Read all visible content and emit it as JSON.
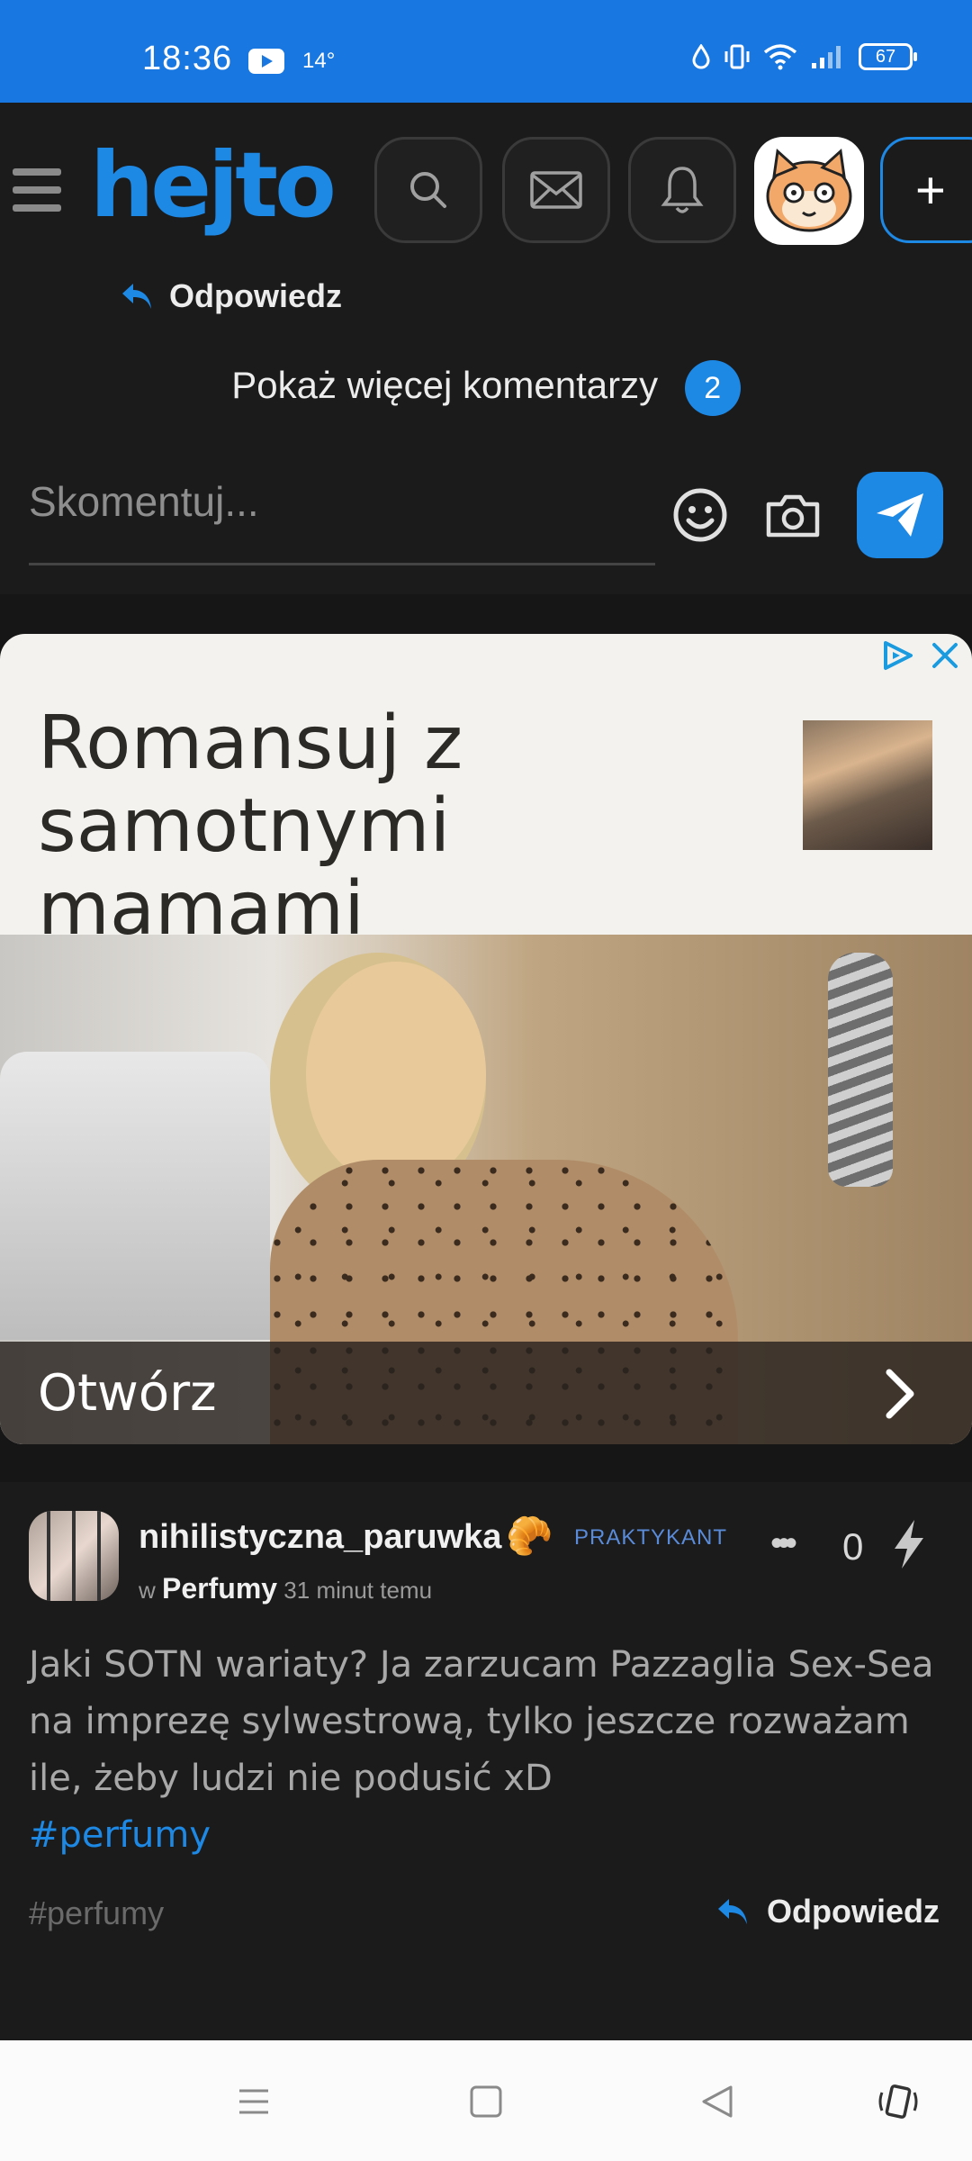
{
  "status_bar": {
    "time": "18:36",
    "temperature": "14°",
    "battery": "67",
    "icons": [
      "youtube-icon",
      "water-drop-icon",
      "vibrate-icon",
      "wifi-icon",
      "signal-icon",
      "battery-icon"
    ]
  },
  "header": {
    "logo": "hejto",
    "icons": [
      "menu-icon",
      "search-icon",
      "mail-icon",
      "bell-icon",
      "avatar",
      "plus-icon"
    ],
    "plus_label": "+",
    "accent": "#1e88e5"
  },
  "comments": {
    "reply_label": "Odpowiedz",
    "show_more_label": "Pokaż więcej komentarzy",
    "show_more_count": "2",
    "comment_placeholder": "Skomentuj..."
  },
  "ad": {
    "title": "Romansuj z samotnymi mamami",
    "cta": "Otwórz",
    "icons": [
      "adchoices-icon",
      "close-icon"
    ]
  },
  "post": {
    "username": "nihilistyczna_paruwka",
    "badge_emoji": "🥐",
    "rank": "PRAKTYKANT",
    "in_prefix": "w",
    "community": "Perfumy",
    "time_ago": "31 minut temu",
    "score": "0",
    "text": "Jaki SOTN wariaty? Ja zarzucam Pazzaglia Sex-Sea na imprezę sylwestrową, tylko jeszcze rozważam ile, żeby ludzi nie podusić xD",
    "hashtag": "#perfumy",
    "footer_tag": "#perfumy",
    "reply_label": "Odpowiedz"
  },
  "nav_bar": {
    "icons": [
      "recents-menu-icon",
      "home-square-icon",
      "back-triangle-icon",
      "rotate-icon"
    ]
  }
}
